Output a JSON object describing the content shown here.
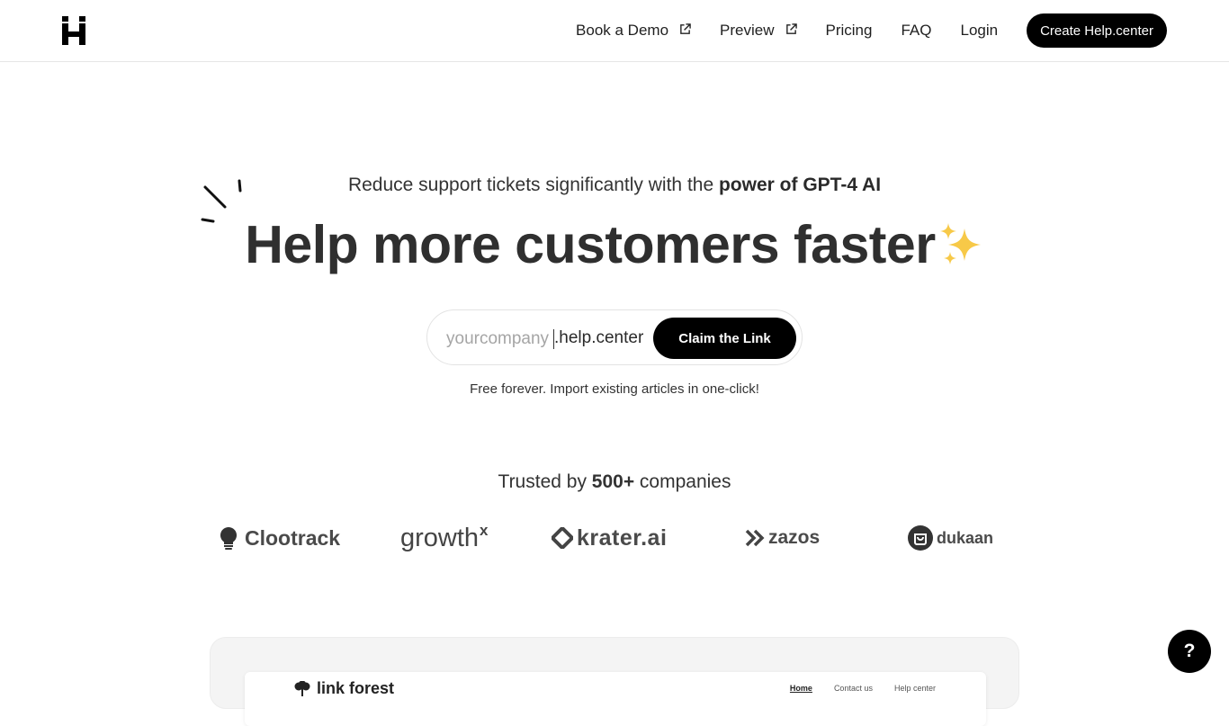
{
  "nav": {
    "links": [
      {
        "label": "Book a Demo",
        "external": true
      },
      {
        "label": "Preview",
        "external": true
      },
      {
        "label": "Pricing",
        "external": false
      },
      {
        "label": "FAQ",
        "external": false
      },
      {
        "label": "Login",
        "external": false
      }
    ],
    "cta_label": "Create Help.center"
  },
  "hero": {
    "tagline_prefix": "Reduce support tickets significantly with the ",
    "tagline_bold": "power of GPT-4 AI",
    "headline": "Help more customers faster",
    "claim": {
      "placeholder": "yourcompany",
      "suffix": ".help.center",
      "button_label": "Claim the Link"
    },
    "subnote": "Free forever. Import existing articles in one-click!"
  },
  "trusted": {
    "prefix": "Trusted by ",
    "count": "500+",
    "suffix": " companies"
  },
  "brands": [
    "Clootrack",
    "growth",
    "krater.ai",
    "zazos",
    "dukaan"
  ],
  "brands_extra": {
    "growth_sup": "x"
  },
  "preview": {
    "brand": "link forest",
    "links": [
      "Home",
      "Contact us",
      "Help center"
    ]
  },
  "help_fab": "?",
  "colors": {
    "primary": "#000000",
    "accent_sparkle": "#f7c948"
  }
}
